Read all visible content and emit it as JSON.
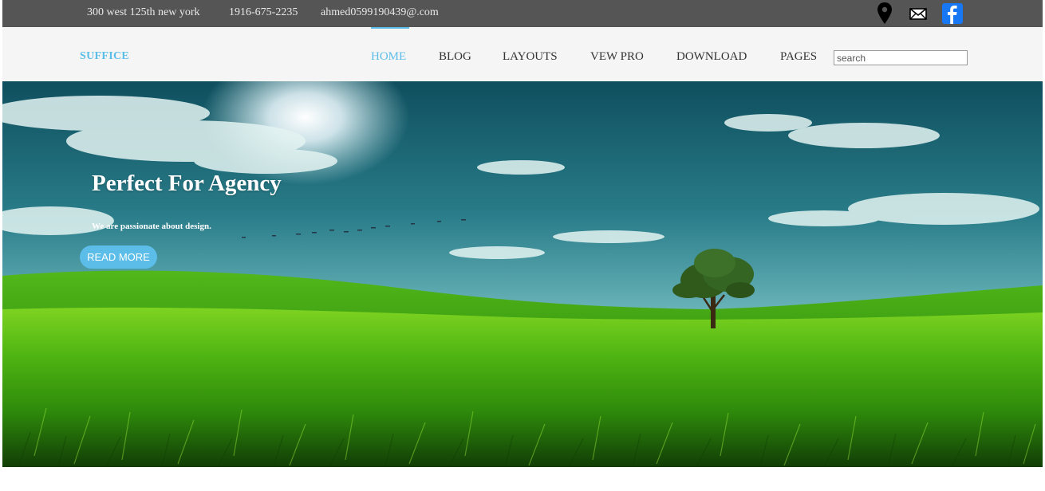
{
  "topbar": {
    "address": "300 west 125th new york",
    "phone": "1916-675-2235",
    "email": "ahmed0599190439@.com",
    "icons": [
      "map-pin-icon",
      "mail-icon",
      "facebook-icon"
    ]
  },
  "navbar": {
    "brand": "SUFFICE",
    "items": [
      {
        "label": "HOME",
        "active": true
      },
      {
        "label": "BLOG",
        "active": false
      },
      {
        "label": "LAYOUTS",
        "active": false
      },
      {
        "label": "VEW PRO",
        "active": false
      },
      {
        "label": "DOWNLOAD",
        "active": false
      },
      {
        "label": "PAGES",
        "active": false
      }
    ],
    "search_placeholder": "search"
  },
  "hero": {
    "title": "Perfect For Agency",
    "subtitle": "We are passionate about design.",
    "button_label": "READ MORE"
  },
  "colors": {
    "accent": "#5bbde8",
    "topbar_bg": "#555555",
    "navbar_bg": "#f5f5f5",
    "facebook_blue": "#1877f2"
  }
}
